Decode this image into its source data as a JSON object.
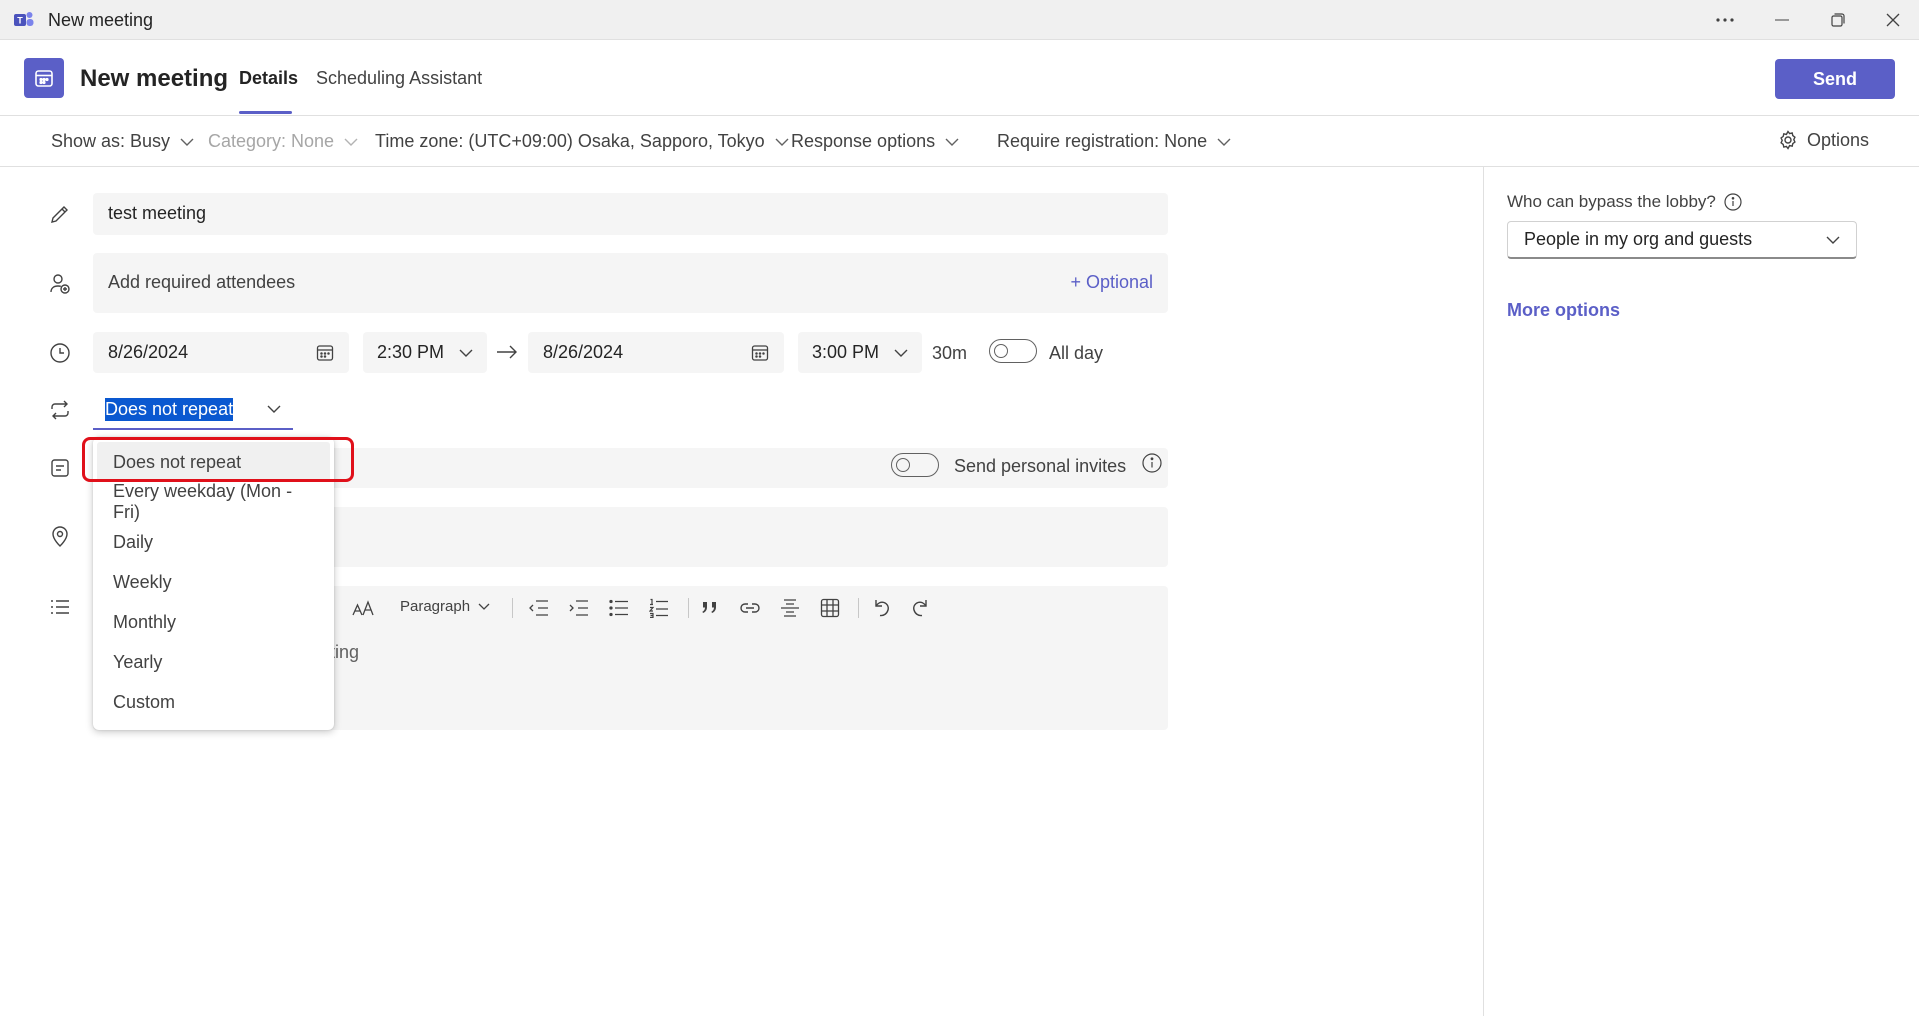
{
  "window": {
    "title": "New meeting"
  },
  "header": {
    "title": "New meeting",
    "tabs": [
      {
        "label": "Details",
        "active": true
      },
      {
        "label": "Scheduling Assistant",
        "active": false
      }
    ],
    "send_label": "Send"
  },
  "options_bar": {
    "show_as": "Show as: Busy",
    "category": "Category: None",
    "time_zone": "Time zone: (UTC+09:00) Osaka, Sapporo, Tokyo",
    "response_options": "Response options",
    "registration": "Require registration: None",
    "options_label": "Options"
  },
  "form": {
    "title_value": "test meeting",
    "attendees_placeholder": "Add required attendees",
    "optional_label": "+ Optional",
    "start_date": "8/26/2024",
    "start_time": "2:30 PM",
    "end_date": "8/26/2024",
    "end_time": "3:00 PM",
    "duration": "30m",
    "all_day_label": "All day",
    "repeat_value": "Does not repeat",
    "personal_invites_label": "Send personal invites",
    "editor_paragraph": "Paragraph",
    "editor_text_fragment": "ting"
  },
  "repeat_dropdown": {
    "options": [
      "Does not repeat",
      "Every weekday (Mon - Fri)",
      "Daily",
      "Weekly",
      "Monthly",
      "Yearly",
      "Custom"
    ],
    "selected_index": 0
  },
  "right_pane": {
    "lobby_label": "Who can bypass the lobby?",
    "lobby_value": "People in my org and guests",
    "more_options": "More options"
  },
  "colors": {
    "brand": "#5b5fc7",
    "selection": "#0a58d0",
    "highlight": "#e0101a"
  }
}
